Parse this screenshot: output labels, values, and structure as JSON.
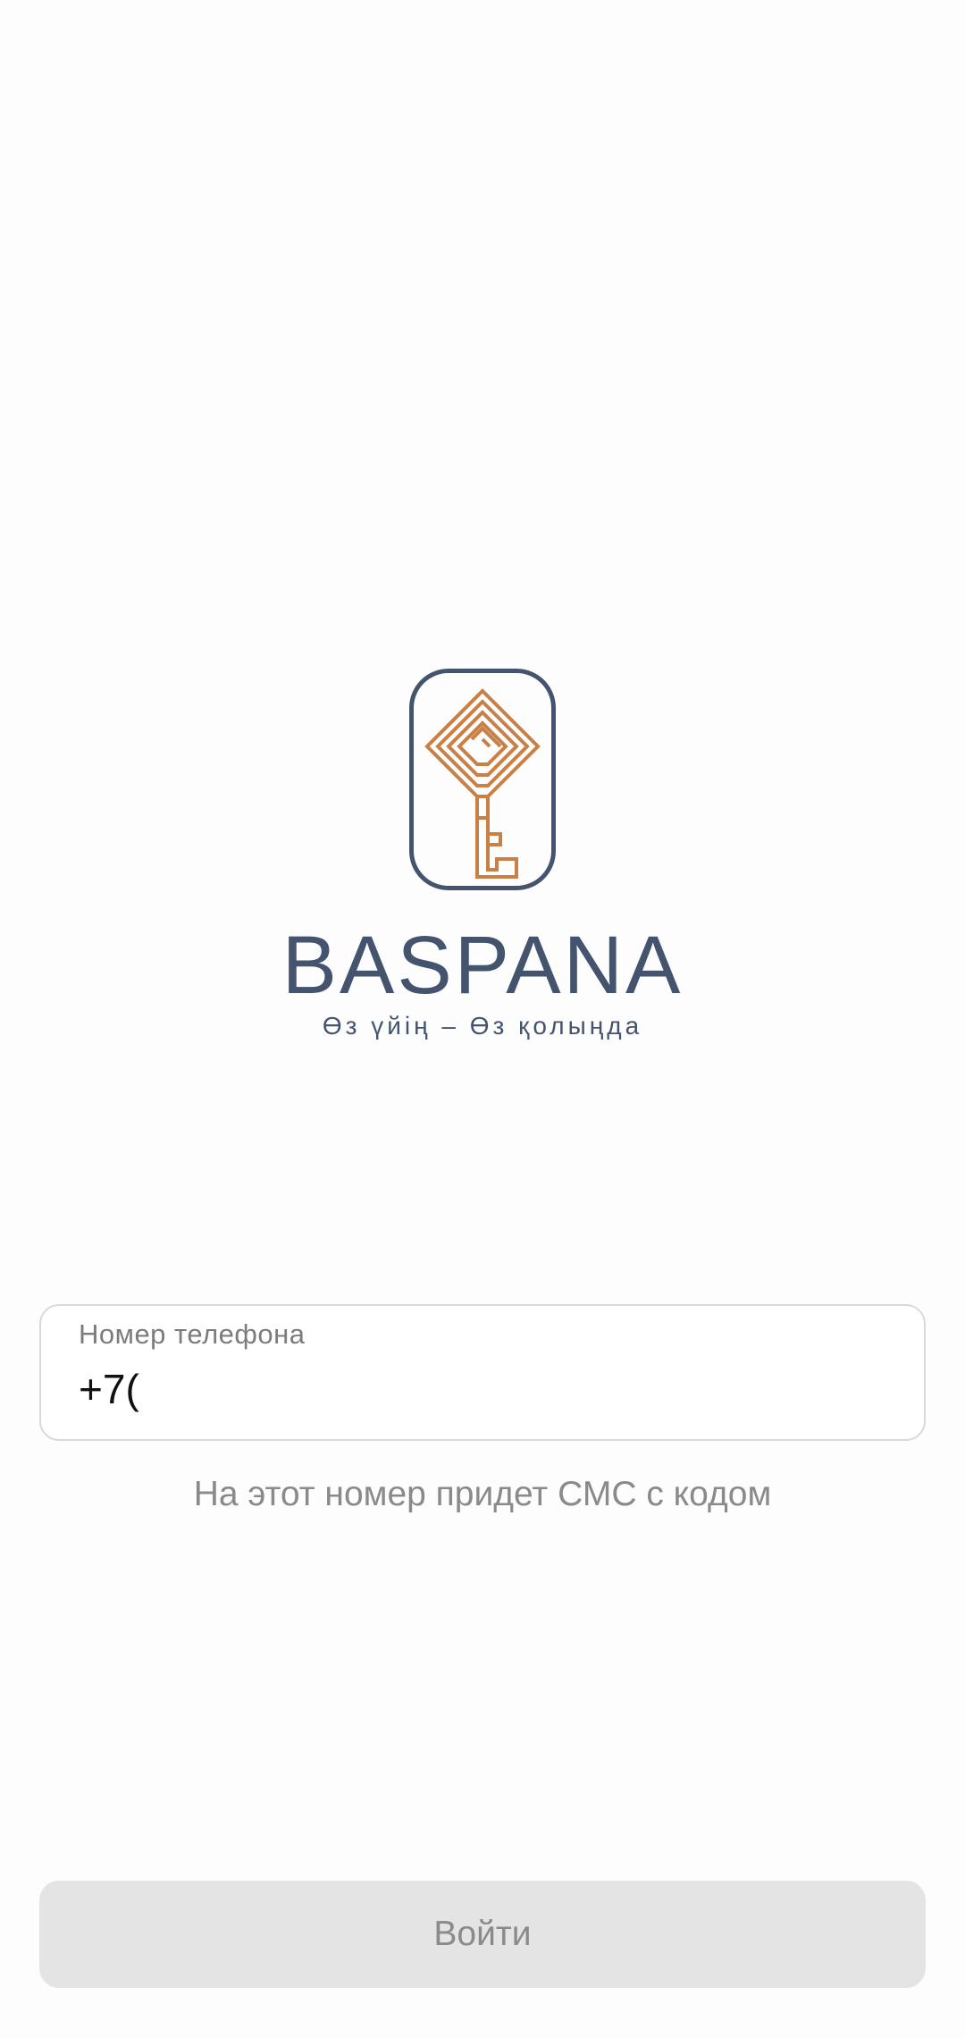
{
  "brand": {
    "name": "BASPANA",
    "slogan": "Өз үйің – Өз қолыңда",
    "logo_icon": "key-icon",
    "colors": {
      "primary": "#44546e",
      "accent": "#c98045"
    }
  },
  "phone": {
    "label": "Номер телефона",
    "value": "+7("
  },
  "hint": "На этот номер придет СМС с кодом",
  "login_button": {
    "label": "Войти"
  }
}
